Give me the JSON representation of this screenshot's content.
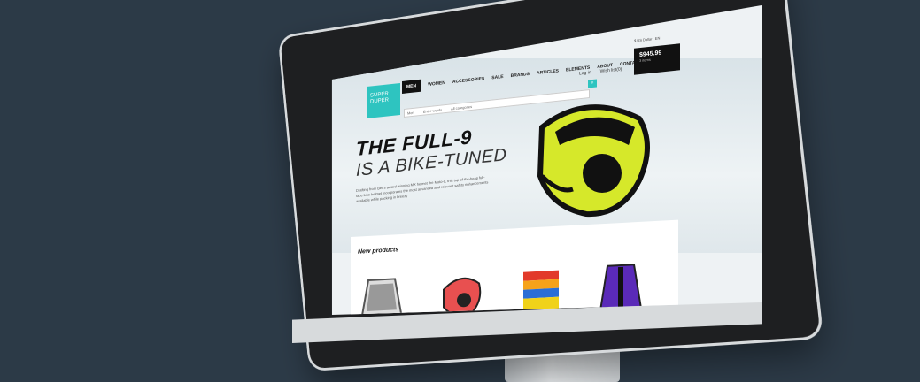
{
  "brand": {
    "line1": "SUPER",
    "line2": "DUPER"
  },
  "nav": {
    "items": [
      "MEN",
      "WOMEN",
      "ACCESSORIES",
      "SALE",
      "BRANDS",
      "ARTICLES",
      "ELEMENTS",
      "ABOUT",
      "CONTACT"
    ],
    "active_index": 0
  },
  "utility": {
    "currency": "$ US Dollar",
    "language": "EN"
  },
  "account_links": {
    "login": "Log in",
    "wishlist": "Wish list(0)"
  },
  "cart": {
    "total": "$945.99",
    "items": "3 items"
  },
  "search": {
    "category": "Men",
    "placeholder": "Enter words",
    "scope": "All categories"
  },
  "hero": {
    "title_line1": "THE FULL-9",
    "title_line2": "IS A BIKE-TUNED",
    "description": "Drafting from Bell's award-winning MX helmet the Moto-9, this top-of-the-heap full-face bike helmet incorporates the most advanced and relevant safety enhancements available while packing in breezy"
  },
  "slider": {
    "prev_icon": "‹",
    "next_icon": "›"
  },
  "products": {
    "title": "New products"
  },
  "colors": {
    "accent": "#2ec4c0",
    "dark": "#111111",
    "bg": "#2c3a47"
  }
}
